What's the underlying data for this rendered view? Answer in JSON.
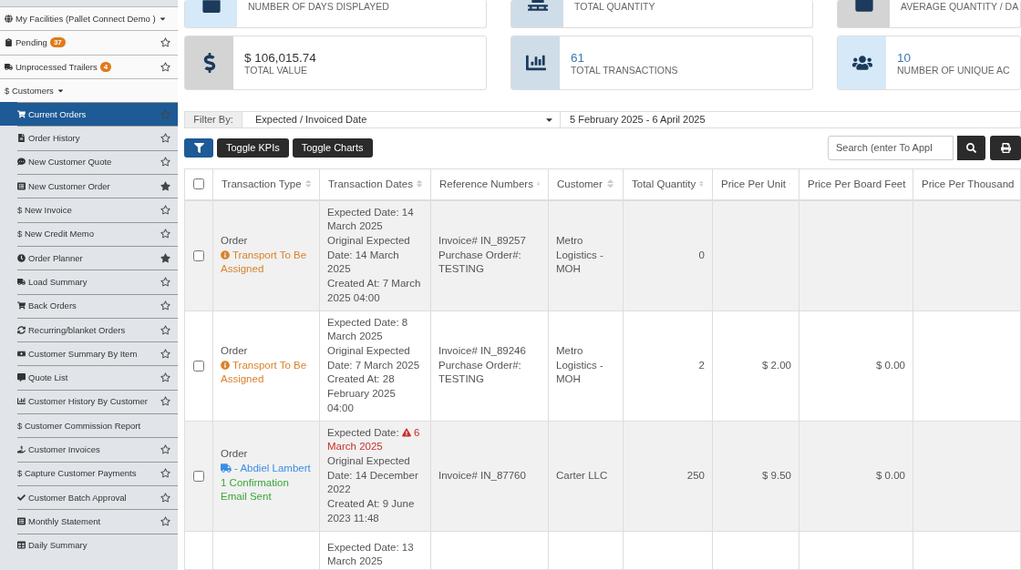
{
  "sidebar": {
    "items": [
      {
        "label": "My Facilities (Pallet Connect Demo )",
        "expandable": true,
        "selected": false
      },
      {
        "label": "Pending",
        "badge": "37",
        "starred": false,
        "selected": false
      },
      {
        "label": "Unprocessed Trailers",
        "badge": "4",
        "starred": false,
        "selected": false
      },
      {
        "label": "$ Customers",
        "expandable": true,
        "selected": false,
        "children": [
          {
            "label": "Current Orders",
            "starred": false,
            "selected": true
          },
          {
            "label": "Order History",
            "starred": false,
            "selected": false
          },
          {
            "label": "New Customer Quote",
            "starred": false,
            "selected": false
          },
          {
            "label": "New Customer Order",
            "starred": true,
            "selected": false
          },
          {
            "label": "$ New Invoice",
            "starred": false,
            "selected": false
          },
          {
            "label": "$ New Credit Memo",
            "starred": false,
            "selected": false
          },
          {
            "label": "Order Planner",
            "starred": true,
            "selected": false
          },
          {
            "label": "Load Summary",
            "starred": false,
            "selected": false
          },
          {
            "label": "Back Orders",
            "starred": false,
            "selected": false
          },
          {
            "label": "Recurring/blanket Orders",
            "starred": false,
            "selected": false
          },
          {
            "label": "Customer Summary By Item",
            "starred": false,
            "selected": false
          },
          {
            "label": "Quote List",
            "starred": false,
            "selected": false
          },
          {
            "label": "Customer History By Customer",
            "starred": false,
            "selected": false
          },
          {
            "label": "$ Customer Commission Report",
            "selected": false
          },
          {
            "label": "Customer Invoices",
            "starred": false,
            "selected": false
          },
          {
            "label": "$ Capture Customer Payments",
            "starred": false,
            "selected": false
          },
          {
            "label": "Customer Batch Approval",
            "starred": false,
            "selected": false
          },
          {
            "label": "Monthly Statement",
            "starred": false,
            "selected": false
          },
          {
            "label": "Daily Summary",
            "selected": false
          }
        ]
      }
    ]
  },
  "kpis": [
    {
      "label": "NUMBER OF DAYS DISPLAYED",
      "color": "#d6e9f8",
      "partial": true
    },
    {
      "label": "TOTAL QUANTITY",
      "color": "#cfdde8",
      "partial": true
    },
    {
      "label": "AVERAGE QUANTITY / DA",
      "color": "#d4d4d4",
      "partial": true
    },
    {
      "value": "$ 106,015.74",
      "label": "TOTAL VALUE",
      "color": "#d4d4d4",
      "accent": false,
      "partial": false
    },
    {
      "value": "61",
      "label": "TOTAL TRANSACTIONS",
      "color": "#cfdde8",
      "accent": true,
      "partial": false
    },
    {
      "value": "10",
      "label": "NUMBER OF UNIQUE AC",
      "color": "#d6e9f8",
      "accent": true,
      "partial": false
    }
  ],
  "filter": {
    "label": "Filter By:",
    "value": "Expected / Invoiced Date",
    "date_range": "5 February 2025 - 6 April 2025"
  },
  "toolbar": {
    "buttons": [
      "Toggle KPIs",
      "Toggle Charts"
    ],
    "search": {
      "placeholder": "Search (enter To Appl"
    }
  },
  "table": {
    "select_all_checked": false,
    "columns": [
      "Transaction Type",
      "Transaction Dates",
      "Reference Numbers",
      "Customer",
      "Total Quantity",
      "Price Per Unit",
      "Price Per Board Feet",
      "Price Per Thousand"
    ],
    "rows": [
      {
        "checked": false,
        "type": "Order",
        "statuses": [
          {
            "kind": "warning",
            "text": "Transport To Be Assigned"
          }
        ],
        "dates": [
          {
            "label": "Expected Date:",
            "value": "14 March 2025",
            "overdue": false
          },
          {
            "label": "Original Expected Date:",
            "value": "14 March 2025",
            "overdue": false
          },
          {
            "label": "Created At:",
            "value": "7 March 2025 04:00",
            "overdue": false
          }
        ],
        "references": [
          "Invoice# IN_89257",
          "Purchase Order#: TESTING"
        ],
        "customer": "Metro Logistics - MOH",
        "quantity": "0"
      },
      {
        "checked": false,
        "type": "Order",
        "statuses": [
          {
            "kind": "warning",
            "text": "Transport To Be Assigned"
          }
        ],
        "dates": [
          {
            "label": "Expected Date:",
            "value": "8 March 2025",
            "overdue": false
          },
          {
            "label": "Original Expected Date:",
            "value": "7 March 2025",
            "overdue": false
          },
          {
            "label": "Created At:",
            "value": "28 February 2025 04:00",
            "overdue": false
          }
        ],
        "references": [
          "Invoice# IN_89246",
          "Purchase Order#: TESTING"
        ],
        "customer": "Metro Logistics - MOH",
        "quantity": "2",
        "price_unit": "$ 2.00",
        "price_board_feet": "$ 0.00"
      },
      {
        "checked": false,
        "type": "Order",
        "statuses": [
          {
            "kind": "driver",
            "text": "- Abdiel Lambert"
          },
          {
            "kind": "email",
            "text": "1 Confirmation Email Sent"
          }
        ],
        "dates": [
          {
            "label": "Expected Date:",
            "value": "6 March 2025",
            "overdue": true
          },
          {
            "label": "Original Expected Date:",
            "value": "14 December 2022",
            "overdue": false
          },
          {
            "label": "Created At:",
            "value": "9 June 2023 11:48",
            "overdue": false
          }
        ],
        "references": [
          "Invoice# IN_87760"
        ],
        "customer": "Carter LLC",
        "quantity": "250",
        "price_unit": "$ 9.50",
        "price_board_feet": "$ 0.00"
      },
      {
        "dates": [
          {
            "label": "Expected Date:",
            "value": "13 March 2025",
            "overdue": false
          }
        ],
        "references": []
      }
    ]
  }
}
